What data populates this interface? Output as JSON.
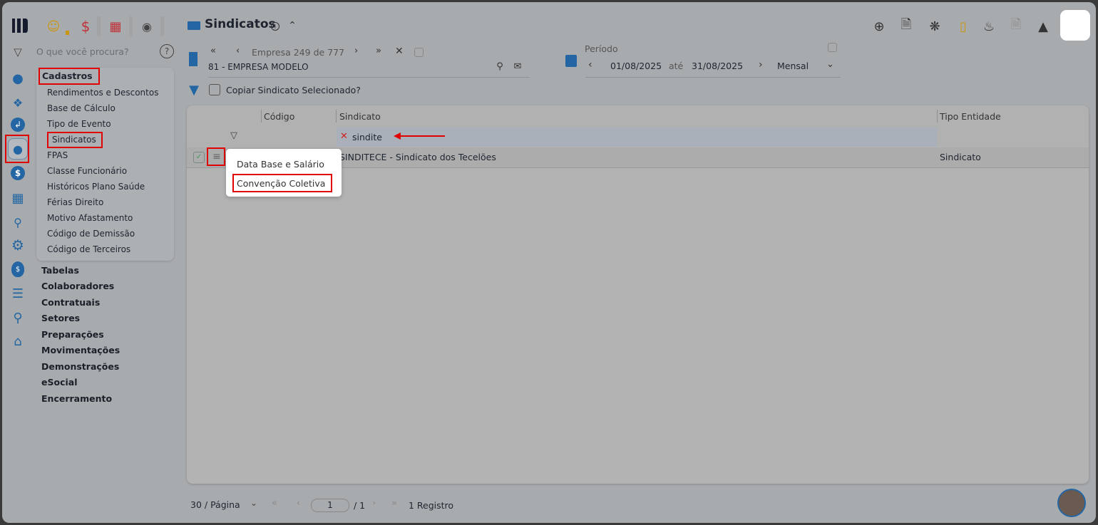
{
  "header": {
    "title": "Sindicatos"
  },
  "search": {
    "placeholder": "O que você procura?"
  },
  "sidebar": {
    "open_group": "Cadastros",
    "submenu": [
      "Rendimentos e Descontos",
      "Base de Cálculo",
      "Tipo de Evento",
      "Sindicatos",
      "FPAS",
      "Classe Funcionário",
      "Históricos Plano Saúde",
      "Férias Direito",
      "Motivo Afastamento",
      "Código de Demissão",
      "Código de Terceiros"
    ],
    "groups": [
      "Tabelas",
      "Colaboradores",
      "Contratuais",
      "Setores",
      "Preparações",
      "Movimentações",
      "Demonstrações",
      "eSocial",
      "Encerramento"
    ]
  },
  "company": {
    "nav_label": "Empresa",
    "index": "249",
    "of_label": "de",
    "total": "777",
    "name": "81 - EMPRESA MODELO"
  },
  "period": {
    "label": "Período",
    "start": "01/08/2025",
    "until_label": "até",
    "end": "31/08/2025",
    "mode": "Mensal"
  },
  "copy_option": {
    "label": "Copiar Sindicato Selecionado?"
  },
  "table": {
    "columns": [
      "Código",
      "Sindicato",
      "Tipo Entidade"
    ],
    "filter_value": "sindite",
    "rows": [
      {
        "codigo": "",
        "sindicato": "SINDITECE - Sindicato dos Tecelões",
        "tipo": "Sindicato"
      }
    ]
  },
  "context_menu": {
    "items": [
      "Data Base e Salário",
      "Convenção Coletiva"
    ]
  },
  "pagination": {
    "per_page": "30 / Página",
    "page": "1",
    "total_pages": "/ 1",
    "records": "1 Registro"
  },
  "colors": {
    "accent": "#2366a3",
    "highlight": "#e00000"
  }
}
